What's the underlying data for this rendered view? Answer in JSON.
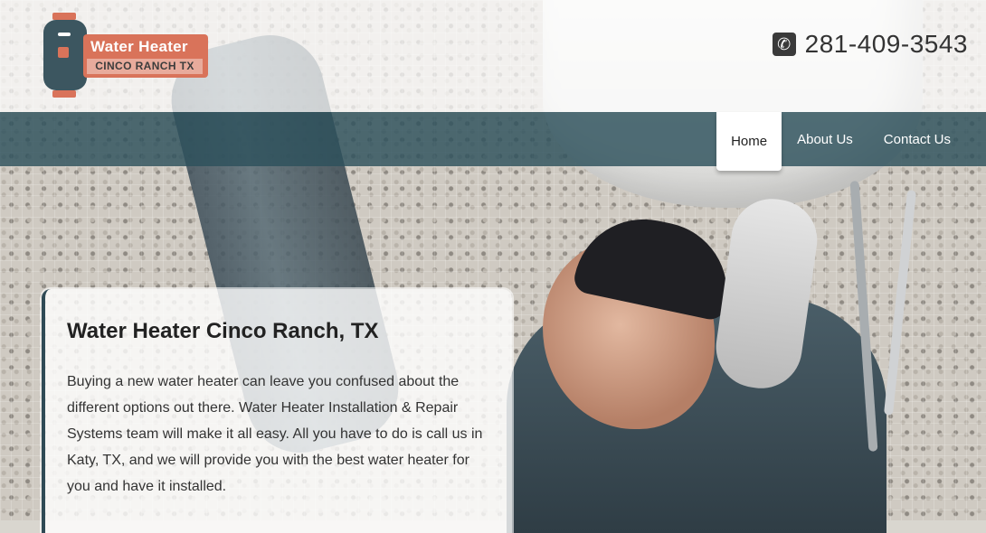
{
  "brand": {
    "line1": "Water Heater",
    "line2": "CINCO RANCH TX",
    "colors": {
      "primary": "#3c5660",
      "accent": "#d9735a"
    }
  },
  "header": {
    "phone_icon": "phone-icon",
    "phone_number": "281-409-3543"
  },
  "nav": {
    "items": [
      {
        "label": "Home",
        "active": true
      },
      {
        "label": "About Us",
        "active": false
      },
      {
        "label": "Contact Us",
        "active": false
      }
    ]
  },
  "hero": {
    "title": "Water Heater Cinco Ranch, TX",
    "body": "Buying a new water heater can leave you confused about the different options out there. Water Heater Installation & Repair Systems team will make it all easy. All you have to do is call us in Katy, TX, and we will provide you with the best water heater for you and have it installed."
  }
}
